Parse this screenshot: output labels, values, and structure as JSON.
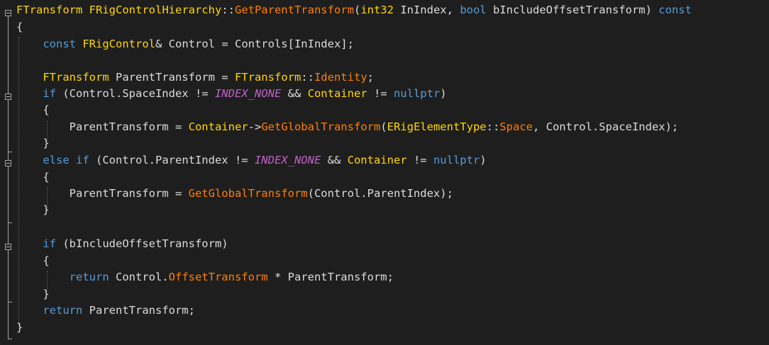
{
  "code": {
    "lines": [
      [
        {
          "t": "FTransform",
          "c": "cls"
        },
        {
          "t": " ",
          "c": "var"
        },
        {
          "t": "FRigControlHierarchy",
          "c": "cls"
        },
        {
          "t": "::",
          "c": "var"
        },
        {
          "t": "GetParentTransform",
          "c": "fn"
        },
        {
          "t": "(",
          "c": "var"
        },
        {
          "t": "int32",
          "c": "cls"
        },
        {
          "t": " InIndex, ",
          "c": "var"
        },
        {
          "t": "bool",
          "c": "kw"
        },
        {
          "t": " bIncludeOffsetTransform) ",
          "c": "var"
        },
        {
          "t": "const",
          "c": "kw"
        }
      ],
      [
        {
          "t": "{",
          "c": "var"
        }
      ],
      [
        {
          "t": "    ",
          "c": "var"
        },
        {
          "t": "const",
          "c": "kw"
        },
        {
          "t": " ",
          "c": "var"
        },
        {
          "t": "FRigControl",
          "c": "cls"
        },
        {
          "t": "& Control = Controls[InIndex];",
          "c": "var"
        }
      ],
      [],
      [
        {
          "t": "    ",
          "c": "var"
        },
        {
          "t": "FTransform",
          "c": "cls"
        },
        {
          "t": " ParentTransform = ",
          "c": "var"
        },
        {
          "t": "FTransform",
          "c": "cls"
        },
        {
          "t": "::",
          "c": "var"
        },
        {
          "t": "Identity",
          "c": "field"
        },
        {
          "t": ";",
          "c": "var"
        }
      ],
      [
        {
          "t": "    ",
          "c": "var"
        },
        {
          "t": "if",
          "c": "kw"
        },
        {
          "t": " (Control.SpaceIndex != ",
          "c": "var"
        },
        {
          "t": "INDEX_NONE",
          "c": "mac"
        },
        {
          "t": " && ",
          "c": "var"
        },
        {
          "t": "Container",
          "c": "cls"
        },
        {
          "t": " != ",
          "c": "var"
        },
        {
          "t": "nullptr",
          "c": "ptr"
        },
        {
          "t": ")",
          "c": "var"
        }
      ],
      [
        {
          "t": "    {",
          "c": "var"
        }
      ],
      [
        {
          "t": "        ParentTransform = ",
          "c": "var"
        },
        {
          "t": "Container",
          "c": "cls"
        },
        {
          "t": "->",
          "c": "var"
        },
        {
          "t": "GetGlobalTransform",
          "c": "fn"
        },
        {
          "t": "(",
          "c": "var"
        },
        {
          "t": "ERigElementType",
          "c": "cls"
        },
        {
          "t": "::",
          "c": "var"
        },
        {
          "t": "Space",
          "c": "field"
        },
        {
          "t": ", Control.SpaceIndex);",
          "c": "var"
        }
      ],
      [
        {
          "t": "    }",
          "c": "var"
        }
      ],
      [
        {
          "t": "    ",
          "c": "var"
        },
        {
          "t": "else",
          "c": "kw"
        },
        {
          "t": " ",
          "c": "var"
        },
        {
          "t": "if",
          "c": "kw"
        },
        {
          "t": " (Control.ParentIndex != ",
          "c": "var"
        },
        {
          "t": "INDEX_NONE",
          "c": "mac"
        },
        {
          "t": " && ",
          "c": "var"
        },
        {
          "t": "Container",
          "c": "cls"
        },
        {
          "t": " != ",
          "c": "var"
        },
        {
          "t": "nullptr",
          "c": "ptr"
        },
        {
          "t": ")",
          "c": "var"
        }
      ],
      [
        {
          "t": "    {",
          "c": "var"
        }
      ],
      [
        {
          "t": "        ParentTransform = ",
          "c": "var"
        },
        {
          "t": "GetGlobalTransform",
          "c": "fn"
        },
        {
          "t": "(Control.ParentIndex);",
          "c": "var"
        }
      ],
      [
        {
          "t": "    }",
          "c": "var"
        }
      ],
      [],
      [
        {
          "t": "    ",
          "c": "var"
        },
        {
          "t": "if",
          "c": "kw"
        },
        {
          "t": " (bIncludeOffsetTransform)",
          "c": "var"
        }
      ],
      [
        {
          "t": "    {",
          "c": "var"
        }
      ],
      [
        {
          "t": "        ",
          "c": "var"
        },
        {
          "t": "return",
          "c": "kw"
        },
        {
          "t": " Control.",
          "c": "var"
        },
        {
          "t": "OffsetTransform",
          "c": "field"
        },
        {
          "t": " * ParentTransform;",
          "c": "var"
        }
      ],
      [
        {
          "t": "    }",
          "c": "var"
        }
      ],
      [
        {
          "t": "    ",
          "c": "var"
        },
        {
          "t": "return",
          "c": "kw"
        },
        {
          "t": " ParentTransform;",
          "c": "var"
        }
      ],
      [
        {
          "t": "}",
          "c": "var"
        }
      ]
    ]
  },
  "colors": {
    "background": "#1e1e1e",
    "keyword": "#569cd6",
    "type": "#ffd700",
    "function": "#ff8000",
    "macro": "#bd63c5",
    "text": "#dcdcdc"
  }
}
